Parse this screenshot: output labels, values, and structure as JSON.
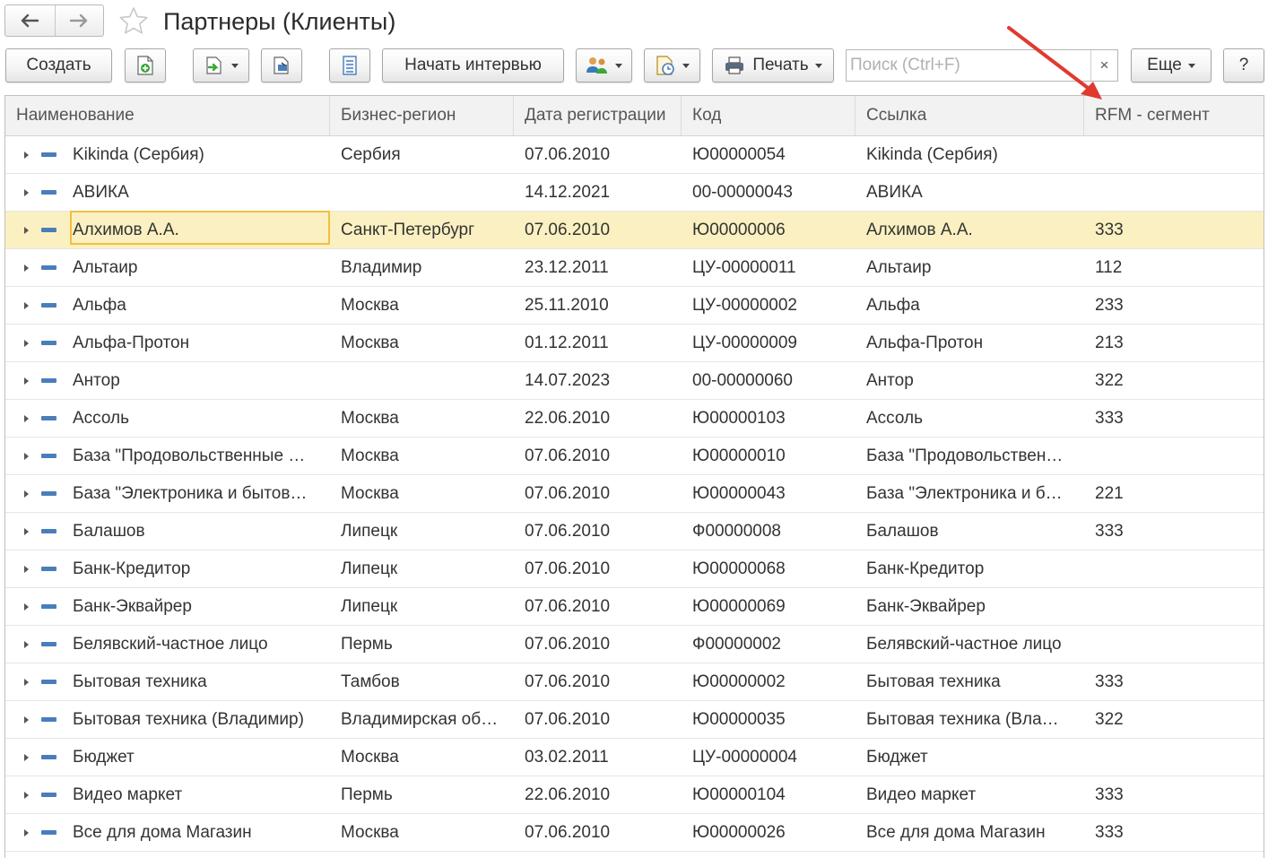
{
  "window": {
    "title": "Партнеры (Клиенты)"
  },
  "nav": {
    "back_icon": "arrow-left-icon",
    "forward_icon": "arrow-right-icon",
    "favorite_icon": "star-icon"
  },
  "toolbar": {
    "create_label": "Создать",
    "interview_label": "Начать интервью",
    "print_label": "Печать",
    "more_label": "Еще",
    "help_label": "?",
    "search": {
      "placeholder": "Поиск (Ctrl+F)",
      "value": "",
      "clear": "×"
    }
  },
  "table": {
    "columns": [
      "Наименование",
      "Бизнес-регион",
      "Дата регистрации",
      "Код",
      "Ссылка",
      "RFM - сегмент"
    ],
    "rows": [
      [
        "Kikinda (Сербия)",
        "Сербия",
        "07.06.2010",
        "Ю00000054",
        "Kikinda (Сербия)",
        ""
      ],
      [
        "АВИКА",
        "",
        "14.12.2021",
        "00-00000043",
        "АВИКА",
        ""
      ],
      [
        "Алхимов А.А.",
        "Санкт-Петербург",
        "07.06.2010",
        "Ю00000006",
        "Алхимов А.А.",
        "333"
      ],
      [
        "Альтаир",
        "Владимир",
        "23.12.2011",
        "ЦУ-00000011",
        "Альтаир",
        "112"
      ],
      [
        "Альфа",
        "Москва",
        "25.11.2010",
        "ЦУ-00000002",
        "Альфа",
        "233"
      ],
      [
        "Альфа-Протон",
        "Москва",
        "01.12.2011",
        "ЦУ-00000009",
        "Альфа-Протон",
        "213"
      ],
      [
        "Антор",
        "",
        "14.07.2023",
        "00-00000060",
        "Антор",
        "322"
      ],
      [
        "Ассоль",
        "Москва",
        "22.06.2010",
        "Ю00000103",
        "Ассоль",
        "333"
      ],
      [
        "База \"Продовольственные …",
        "Москва",
        "07.06.2010",
        "Ю00000010",
        "База \"Продовольствен…",
        ""
      ],
      [
        "База \"Электроника и бытов…",
        "Москва",
        "07.06.2010",
        "Ю00000043",
        "База \"Электроника и б…",
        "221"
      ],
      [
        "Балашов",
        "Липецк",
        "07.06.2010",
        "Ф00000008",
        "Балашов",
        "333"
      ],
      [
        "Банк-Кредитор",
        "Липецк",
        "07.06.2010",
        "Ю00000068",
        "Банк-Кредитор",
        ""
      ],
      [
        "Банк-Эквайрер",
        "Липецк",
        "07.06.2010",
        "Ю00000069",
        "Банк-Эквайрер",
        ""
      ],
      [
        "Белявский-частное лицо",
        "Пермь",
        "07.06.2010",
        "Ф00000002",
        "Белявский-частное лицо",
        ""
      ],
      [
        "Бытовая техника",
        "Тамбов",
        "07.06.2010",
        "Ю00000002",
        "Бытовая техника",
        "333"
      ],
      [
        "Бытовая техника (Владимир)",
        "Владимирская об…",
        "07.06.2010",
        "Ю00000035",
        "Бытовая техника (Вла…",
        "322"
      ],
      [
        "Бюджет",
        "Москва",
        "03.02.2011",
        "ЦУ-00000004",
        "Бюджет",
        ""
      ],
      [
        "Видео маркет",
        "Пермь",
        "22.06.2010",
        "Ю00000104",
        "Видео маркет",
        "333"
      ],
      [
        "Все для дома Магазин",
        "Москва",
        "07.06.2010",
        "Ю00000026",
        "Все для дома Магазин",
        "333"
      ]
    ],
    "selected_row": 2
  },
  "colors": {
    "selected_row": "#fbf0c1",
    "focus_border": "#f0c040",
    "annotation_arrow": "#e03a2f",
    "item_icon": "#4a7ebb"
  }
}
